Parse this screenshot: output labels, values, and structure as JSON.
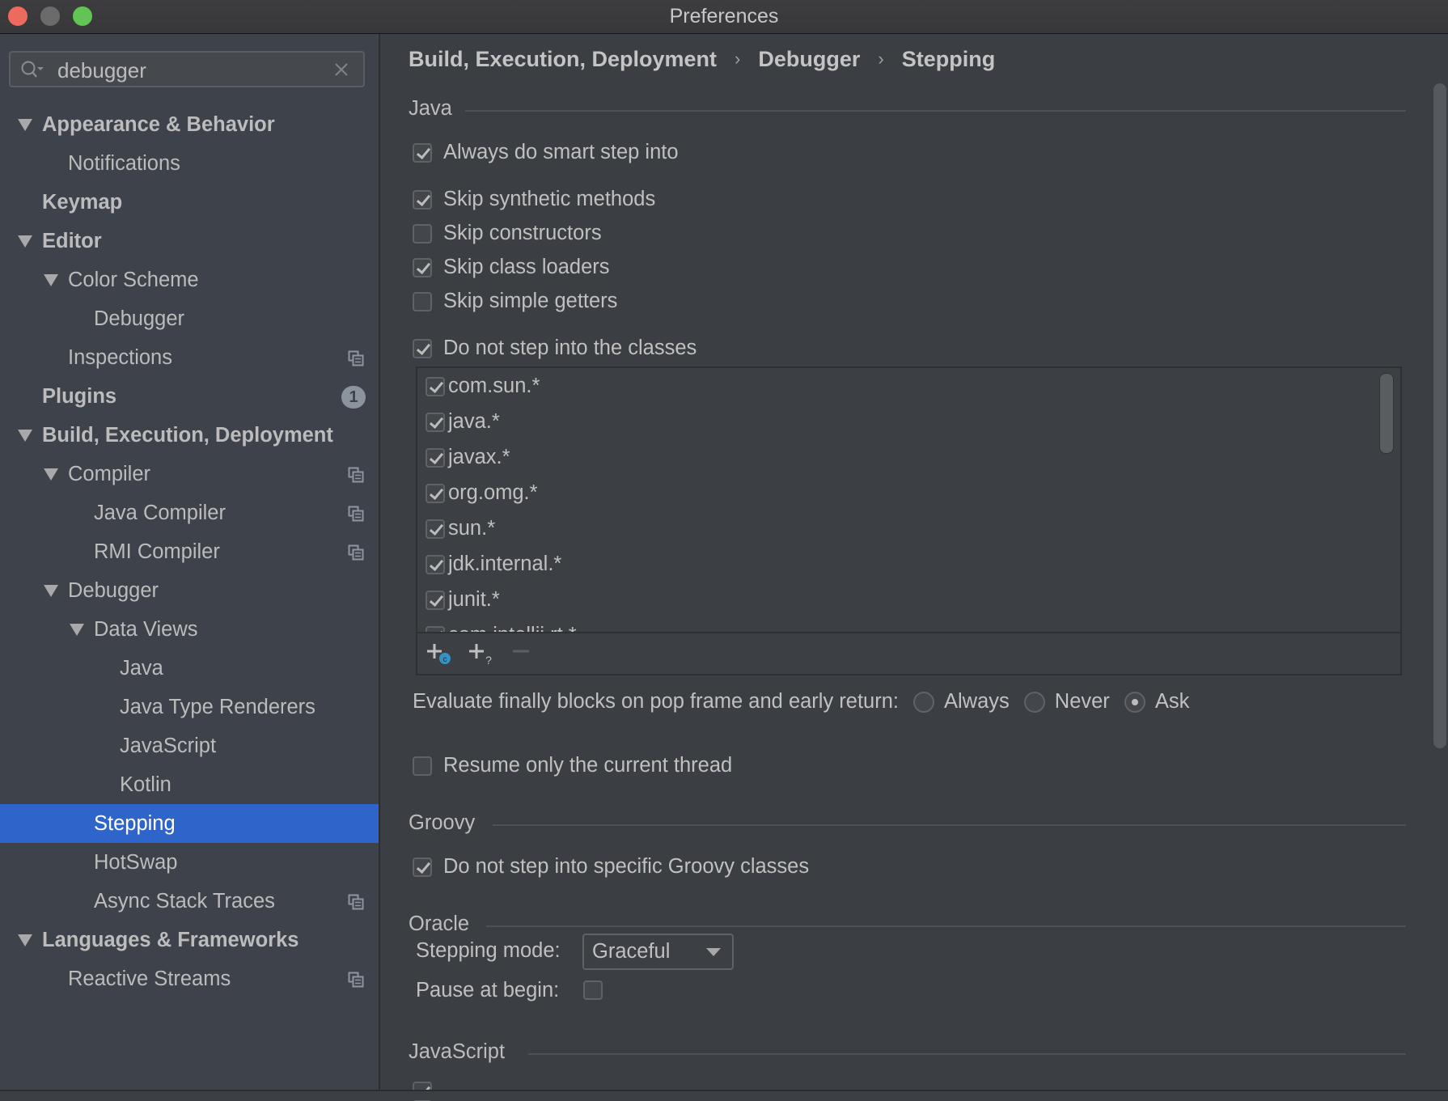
{
  "window": {
    "title": "Preferences"
  },
  "search": {
    "value": "debugger",
    "placeholder": ""
  },
  "sidebar": {
    "items": [
      {
        "label": "Appearance & Behavior",
        "level": 0,
        "bold": true,
        "expanded": true
      },
      {
        "label": "Notifications",
        "level": 1
      },
      {
        "label": "Keymap",
        "level": 0,
        "bold": true
      },
      {
        "label": "Editor",
        "level": 0,
        "bold": true,
        "expanded": true
      },
      {
        "label": "Color Scheme",
        "level": 1,
        "expanded": true
      },
      {
        "label": "Debugger",
        "level": 2
      },
      {
        "label": "Inspections",
        "level": 1,
        "project_icon": true
      },
      {
        "label": "Plugins",
        "level": 0,
        "bold": true,
        "badge": "1"
      },
      {
        "label": "Build, Execution, Deployment",
        "level": 0,
        "bold": true,
        "expanded": true
      },
      {
        "label": "Compiler",
        "level": 1,
        "expanded": true,
        "project_icon": true
      },
      {
        "label": "Java Compiler",
        "level": 2,
        "project_icon": true
      },
      {
        "label": "RMI Compiler",
        "level": 2,
        "project_icon": true
      },
      {
        "label": "Debugger",
        "level": 1,
        "expanded": true
      },
      {
        "label": "Data Views",
        "level": 2,
        "expanded": true
      },
      {
        "label": "Java",
        "level": 3
      },
      {
        "label": "Java Type Renderers",
        "level": 3
      },
      {
        "label": "JavaScript",
        "level": 3
      },
      {
        "label": "Kotlin",
        "level": 3
      },
      {
        "label": "Stepping",
        "level": 2,
        "selected": true
      },
      {
        "label": "HotSwap",
        "level": 2
      },
      {
        "label": "Async Stack Traces",
        "level": 2,
        "project_icon": true
      },
      {
        "label": "Languages & Frameworks",
        "level": 0,
        "bold": true,
        "expanded": true
      },
      {
        "label": "Reactive Streams",
        "level": 1,
        "project_icon": true
      }
    ]
  },
  "breadcrumb": [
    "Build, Execution, Deployment",
    "Debugger",
    "Stepping"
  ],
  "breadcrumb_separator": "›",
  "java": {
    "title": "Java",
    "options": [
      {
        "label": "Always do smart step into",
        "checked": true
      },
      {
        "label": "Skip synthetic methods",
        "checked": true
      },
      {
        "label": "Skip constructors",
        "checked": false
      },
      {
        "label": "Skip class loaders",
        "checked": true
      },
      {
        "label": "Skip simple getters",
        "checked": false
      },
      {
        "label": "Do not step into the classes",
        "checked": true
      }
    ],
    "classes": [
      {
        "pattern": "com.sun.*",
        "checked": true
      },
      {
        "pattern": "java.*",
        "checked": true
      },
      {
        "pattern": "javax.*",
        "checked": true
      },
      {
        "pattern": "org.omg.*",
        "checked": true
      },
      {
        "pattern": "sun.*",
        "checked": true
      },
      {
        "pattern": "jdk.internal.*",
        "checked": true
      },
      {
        "pattern": "junit.*",
        "checked": true
      },
      {
        "pattern": "com.intellij.rt.*",
        "checked": true
      }
    ],
    "toolbar": {
      "add_class": "Add Class",
      "add_pattern": "Add Pattern",
      "remove": "Remove"
    },
    "evaluate_finally": {
      "label": "Evaluate finally blocks on pop frame and early return:",
      "options": [
        "Always",
        "Never",
        "Ask"
      ],
      "selected": "Ask"
    },
    "resume_only_current": {
      "label": "Resume only the current thread",
      "checked": false
    }
  },
  "groovy": {
    "title": "Groovy",
    "option": {
      "label": "Do not step into specific Groovy classes",
      "checked": true
    }
  },
  "oracle": {
    "title": "Oracle",
    "stepping_mode_label": "Stepping mode:",
    "stepping_mode_value": "Graceful",
    "pause_label": "Pause at begin:",
    "pause_checked": false
  },
  "javascript": {
    "title": "JavaScript"
  },
  "colors": {
    "selection": "#2f65ca",
    "background": "#3b3e42",
    "sidebar": "#3e424a",
    "badge": "#8b939c",
    "accent_badge": "#3592c4"
  }
}
